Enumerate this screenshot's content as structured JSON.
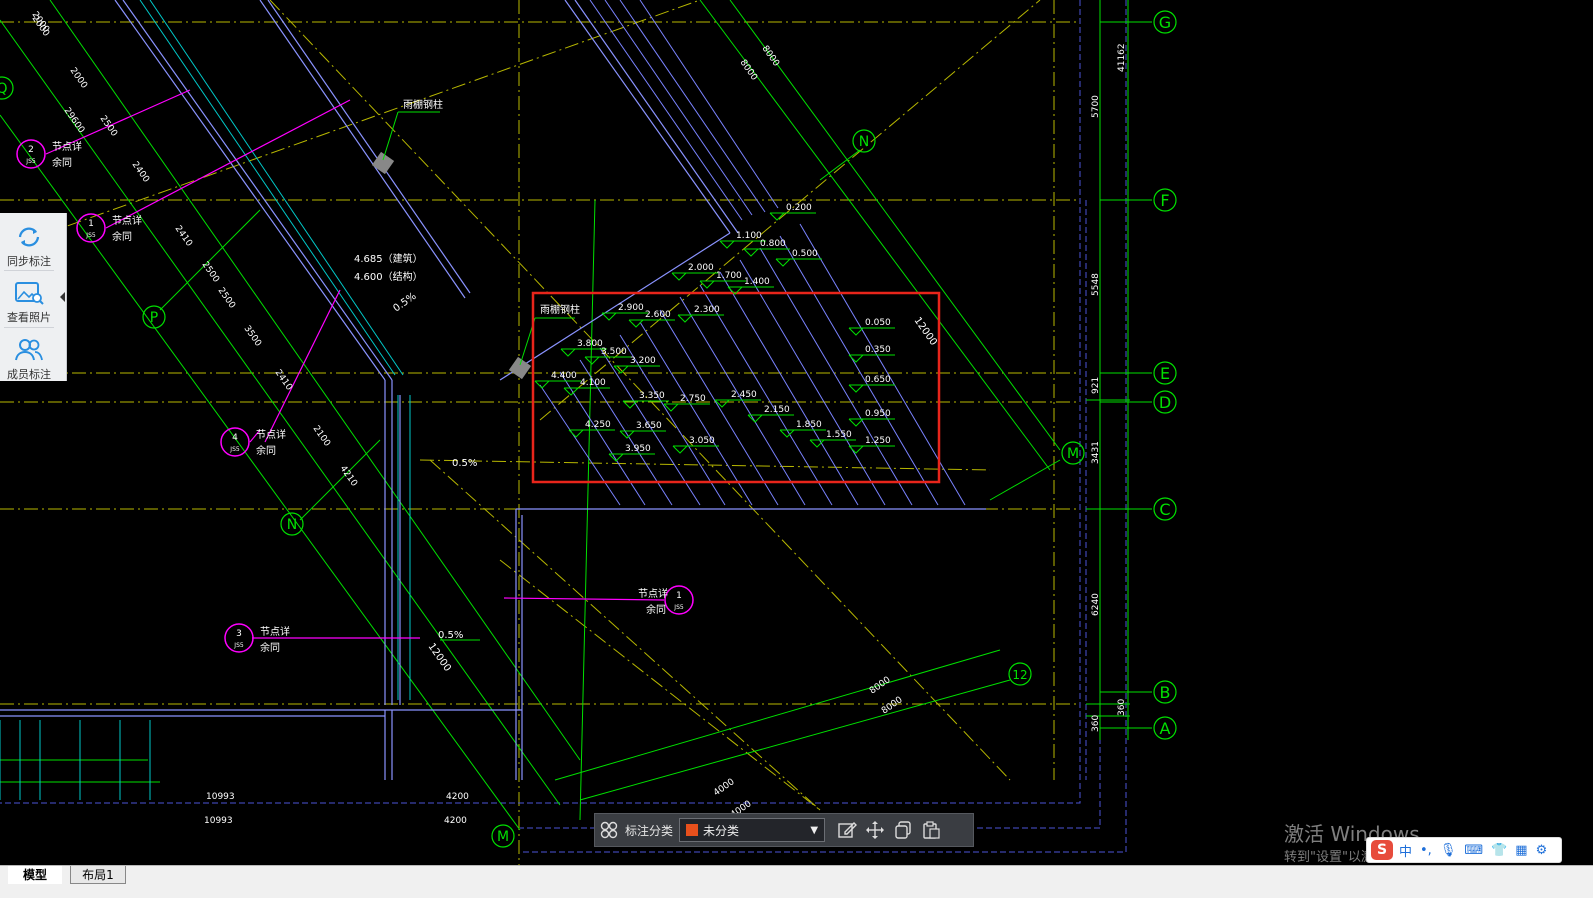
{
  "drawing": {
    "grid_labels_right": [
      "G",
      "F",
      "E",
      "D",
      "C",
      "B",
      "A"
    ],
    "grid_labels_diag": [
      "N",
      "M",
      "12",
      "P",
      "N",
      "M",
      "Q"
    ],
    "right_dims": [
      "41162",
      "5700",
      "5548",
      "921",
      "3431",
      "6240",
      "360",
      "360"
    ],
    "top_dims": [
      "2000",
      "8000",
      "8000"
    ],
    "left_dims": [
      "2000",
      "2000",
      "29600",
      "2500",
      "2400",
      "2410",
      "2500",
      "2500",
      "3500",
      "2410",
      "2100",
      "4210"
    ],
    "bottom_dims": [
      "10993",
      "4200",
      "10993",
      "4200",
      "4000",
      "4000",
      "8000",
      "8000"
    ],
    "canopy_label_1": "雨棚钢柱",
    "canopy_label_2": "雨棚钢柱",
    "elev_arch": "4.685（建筑）",
    "elev_struct": "4.600（结构）",
    "slope_1": "0.5%",
    "slope_2": "0.5%",
    "slope_3": "0.5%",
    "dim_12000": "12000",
    "dim_12000b": "12000",
    "callouts": [
      {
        "num": "2",
        "sub": "JS5",
        "t1": "节点详",
        "t2": "余同"
      },
      {
        "num": "1",
        "sub": "JS5",
        "t1": "节点详",
        "t2": "余同"
      },
      {
        "num": "4",
        "sub": "JS5",
        "t1": "节点详",
        "t2": "余同"
      },
      {
        "num": "3",
        "sub": "JS5",
        "t1": "节点详",
        "t2": "余同"
      },
      {
        "num": "1",
        "sub": "JS5",
        "t1": "节点详",
        "t2": "余同"
      }
    ],
    "elevations": [
      "0.200",
      "1.100",
      "0.800",
      "0.500",
      "2.000",
      "1.700",
      "1.400",
      "2.900",
      "2.600",
      "2.300",
      "0.050",
      "3.800",
      "3.500",
      "3.200",
      "0.350",
      "4.400",
      "4.100",
      "0.650",
      "3.350",
      "2.750",
      "2.450",
      "2.150",
      "0.950",
      "4.250",
      "3.650",
      "3.050",
      "1.850",
      "1.550",
      "1.250",
      "3.950"
    ]
  },
  "side_panel": {
    "items": [
      {
        "label": "同步标注",
        "icon": "sync-icon"
      },
      {
        "label": "查看照片",
        "icon": "photo-icon"
      },
      {
        "label": "成员标注",
        "icon": "members-icon"
      }
    ]
  },
  "annotation_toolbar": {
    "category_label": "标注分类",
    "category_value": "未分类",
    "swatch_color": "#e8501c"
  },
  "tabs": {
    "model": "模型",
    "layout1": "布局1"
  },
  "watermark": {
    "line1": "激活 Windows",
    "line2": "转到\"设置\"以激活 Windows。"
  },
  "ime": {
    "lang": "中"
  },
  "colors": {
    "green": "#00ff00",
    "magenta": "#ff00ff",
    "yellow_dash": "#c8c800",
    "highlight": "#e8251b",
    "blue_lines": "#6f78e8"
  }
}
